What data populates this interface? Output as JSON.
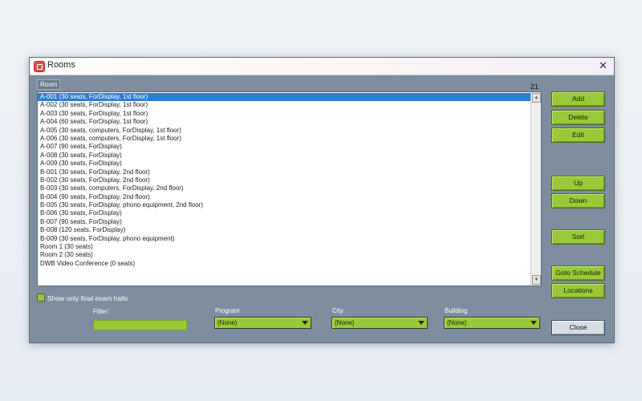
{
  "window": {
    "title": "Rooms",
    "close_icon": "close-icon"
  },
  "list": {
    "header": "Room",
    "count": "21",
    "items": [
      "A-001 (30 seats, ForDisplay, 1st floor)",
      "A-002 (30 seats, ForDisplay, 1st floor)",
      "A-003 (30 seats, ForDisplay, 1st floor)",
      "A-004 (60 seats, ForDisplay, 1st floor)",
      "A-005 (30 seats, computers, ForDisplay, 1st floor)",
      "A-006 (30 seats, computers, ForDisplay, 1st floor)",
      "A-007 (90 seats, ForDisplay)",
      "A-008 (30 seats, ForDisplay)",
      "A-009 (30 seats, ForDisplay)",
      "B-001 (30 seats, ForDisplay, 2nd floor)",
      "B-002 (30 seats, ForDisplay, 2nd floor)",
      "B-003 (30 seats, computers, ForDisplay, 2nd floor)",
      "B-004 (90 seats, ForDisplay, 2nd floor)",
      "B-005 (30 seats, ForDisplay, phono equipment, 2nd floor)",
      "B-006 (30 seats, ForDisplay)",
      "B-007 (90 seats, ForDisplay)",
      "B-008 (120 seats, ForDisplay)",
      "B-009 (30 seats, ForDisplay, phono equipment)",
      "Room 1 (30 seats)",
      "Room 2 (30 seats)",
      "DWB Video Conference (0 seats)"
    ],
    "selected_index": 0
  },
  "buttons": {
    "add": "Add",
    "delete": "Delete",
    "edit": "Edit",
    "up": "Up",
    "down": "Down",
    "sort": "Sort",
    "goto_schedule": "Goto Schedule",
    "locations": "Locations",
    "close": "Close"
  },
  "checkbox": {
    "label": "Show only final exam halls",
    "checked": false
  },
  "filter": {
    "label": "Filter:",
    "value": ""
  },
  "program": {
    "label": "Program",
    "selected": "(None)"
  },
  "city": {
    "label": "City",
    "selected": "(None)"
  },
  "building": {
    "label": "Building",
    "selected": "(None)"
  },
  "colors": {
    "window_bg": "#7e8ea0",
    "accent_green": "#98c93a",
    "selection_blue": "#2a7fd4"
  }
}
